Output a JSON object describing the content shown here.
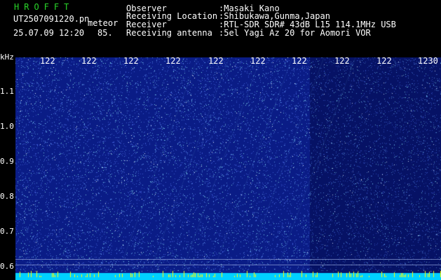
{
  "app": {
    "name": "HROFFT"
  },
  "file": {
    "name": "UT2507091220.pn",
    "tag": "meteor",
    "datetime": "25.07.09 12:20",
    "level": "85."
  },
  "info": {
    "labels": [
      "Observer",
      "Receiving Location",
      "Receiver",
      "Receiving antenna"
    ],
    "values": [
      ":Masaki Kano",
      ":Shibukawa,Gunma,Japan",
      ":RTL-SDR SDR# 43dB L15 114.1MHz USB",
      ":5el Yagi Az 20 for Aomori VOR"
    ]
  },
  "axis": {
    "y_unit": "kHz",
    "y_ticks": [
      "1.1",
      "1.0",
      "0.9",
      "0.8",
      "0.7",
      "0.6"
    ],
    "x_ticks": [
      "122",
      "122",
      "122",
      "122",
      "122",
      "122",
      "122",
      "122",
      "122",
      "1230"
    ]
  },
  "colors": {
    "background": "#000000",
    "app_title": "#29d629",
    "waterfall_base": "#0a1c86",
    "baseline": "#00d0ff",
    "spikes": "#ffff00"
  }
}
